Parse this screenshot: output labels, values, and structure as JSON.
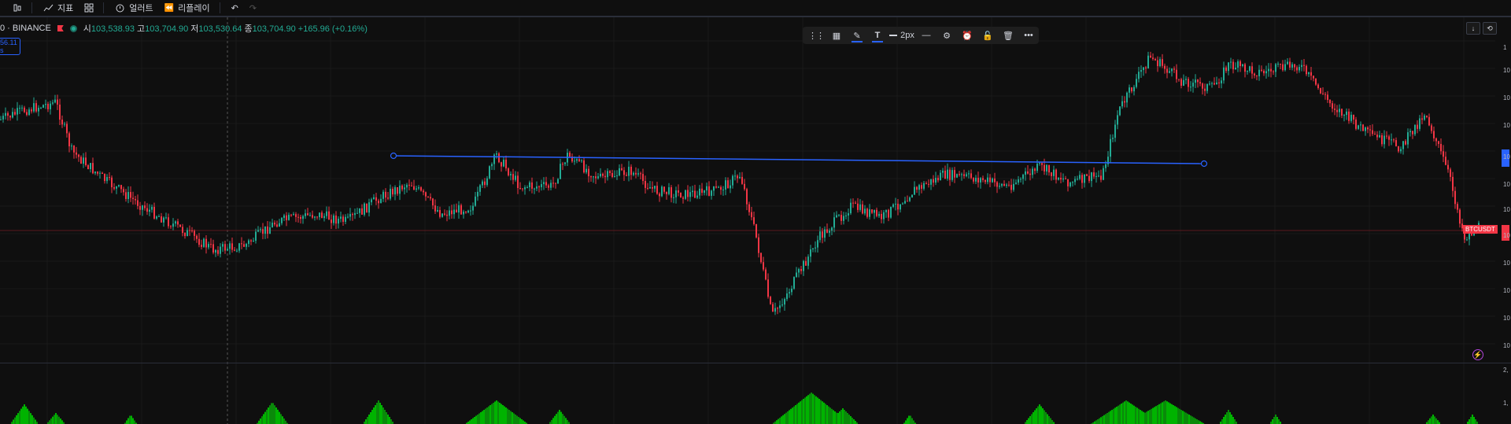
{
  "toolbar": {
    "indicators_label": "지표",
    "alert_label": "얼러트",
    "replay_label": "리플레이"
  },
  "legend": {
    "symbol": "0 · BINANCE",
    "open_label": "시",
    "open": "103,538.93",
    "high_label": "고",
    "high": "103,704.90",
    "low_label": "저",
    "low": "103,530.64",
    "close_label": "종",
    "close": "103,704.90",
    "change": "+165.96 (+0.16%)"
  },
  "price_chip": {
    "line1": "56.11",
    "line2": "s"
  },
  "draw_toolbar": {
    "width_label": "2px"
  },
  "tags": {
    "symbol_tag": "BTCUSDT"
  },
  "axis_fragments": [
    "1",
    "10",
    "10",
    "10",
    "10",
    "10",
    "10",
    "10",
    "10",
    "10",
    "10",
    "10",
    "2,",
    "1,"
  ],
  "colors": {
    "background": "#0f0f0f",
    "up": "#22ab94",
    "down": "#f23645",
    "trendline": "#2962ff",
    "volume": "#00c000"
  },
  "chart_data": {
    "type": "candlestick",
    "trendline": {
      "from": [
        500,
        198
      ],
      "to": [
        1530,
        208
      ]
    }
  }
}
